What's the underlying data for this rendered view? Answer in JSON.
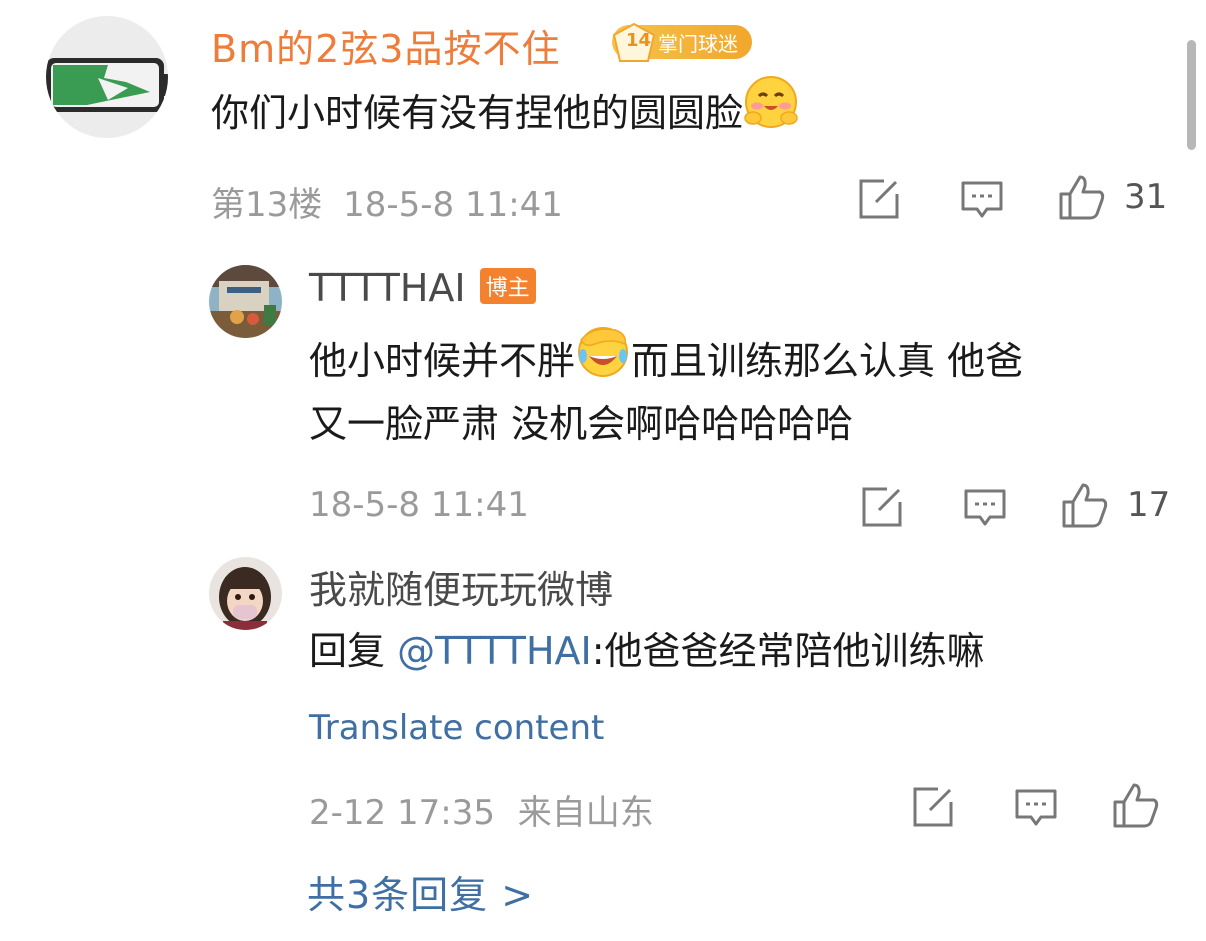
{
  "scrollbar": {
    "color": "#b7b7b7"
  },
  "comment": {
    "username": "Bm的2弦3品按不住",
    "fan_badge": {
      "level": "14",
      "label": "掌门球迷"
    },
    "text": "你们小时候有没有捏他的圆圆脸",
    "emoji": "blush-hands-emoji",
    "floor": "第13楼",
    "datetime": "18-5-8 11:41",
    "like_count": "31"
  },
  "replies": [
    {
      "username": "TTTTHAI",
      "badge": "博主",
      "text_part1": "他小时候并不胖",
      "emoji": "facepalm-laugh-emoji",
      "text_part2": "而且训练那么认真 他爸",
      "text_line2": "又一脸严肃 没机会啊哈哈哈哈哈",
      "datetime": "18-5-8 11:41",
      "like_count": "17"
    },
    {
      "username": "我就随便玩玩微博",
      "reply_prefix": "回复 ",
      "mention": "@TTTTHAI",
      "text": ":他爸爸经常陪他训练嘛",
      "translate": "Translate content",
      "datetime": "2-12 17:35",
      "location": "来自山东"
    }
  ],
  "more_replies": "共3条回复 >",
  "colors": {
    "username_orange": "#ee7c3a",
    "link_blue": "#3f6fa3",
    "meta_gray": "#9a9a9a",
    "blogger_badge": "#f3812d"
  }
}
